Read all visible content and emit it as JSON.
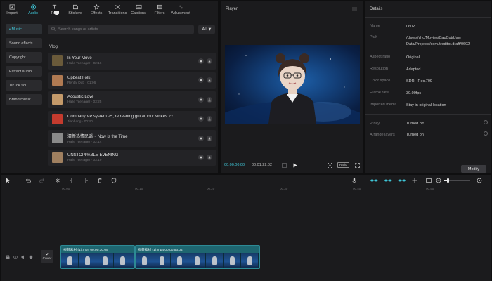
{
  "toolbar": {
    "items": [
      {
        "label": "Import",
        "icon": "import-icon"
      },
      {
        "label": "Audio",
        "icon": "audio-icon",
        "active": true
      },
      {
        "label": "Text",
        "icon": "text-icon"
      },
      {
        "label": "Stickers",
        "icon": "stickers-icon"
      },
      {
        "label": "Effects",
        "icon": "effects-icon"
      },
      {
        "label": "Transitions",
        "icon": "transitions-icon"
      },
      {
        "label": "Captions",
        "icon": "captions-icon"
      },
      {
        "label": "Filters",
        "icon": "filters-icon"
      },
      {
        "label": "Adjustment",
        "icon": "adjustment-icon"
      }
    ]
  },
  "sidebar": {
    "items": [
      {
        "label": "• Music",
        "active": true
      },
      {
        "label": "Sound effects"
      },
      {
        "label": "Copyright"
      },
      {
        "label": "Extract audio"
      },
      {
        "label": "TikTok sou..."
      },
      {
        "label": "Brand music"
      }
    ]
  },
  "search": {
    "placeholder": "Search songs or artists",
    "filter_label": "All"
  },
  "music": {
    "section": "Vlog",
    "tracks": [
      {
        "title": "Is Your Move",
        "sub": "Halle Teenager · 02:16",
        "thumb": "#6a5a3a"
      },
      {
        "title": "Upbeat Folk",
        "sub": "Rental Dub · 01:06",
        "thumb": "#b07a52"
      },
      {
        "title": "Acoustic Love",
        "sub": "Halle Teenager · 03:25",
        "thumb": "#c49a6a"
      },
      {
        "title": "Company VP system 25, refreshing guitar four strikes 2c",
        "sub": "Jianhang · 00:40",
        "thumb": "#c43b2e"
      },
      {
        "title": "清新热情民谣 ~ Now is the Time",
        "sub": "Halle Teenager · 02:14",
        "thumb": "#8a8a8a"
      },
      {
        "title": "UNSTOPPABLE EVENING",
        "sub": "Halle Teenager · 03:19",
        "thumb": "#a08060"
      }
    ]
  },
  "player": {
    "title": "Player",
    "current_time": "00:00:00:00",
    "total_time": "00:01:22:02",
    "ratio_label": "Ratio"
  },
  "details": {
    "title": "Details",
    "rows": [
      {
        "key": "Name",
        "value": "0602"
      },
      {
        "key": "Path",
        "value": "/Users/yhc/Movies/CapCut/User Data/Projects/com.lveditor.draft/0602"
      },
      {
        "key": "Aspect ratio",
        "value": "Original"
      },
      {
        "key": "Resolution",
        "value": "Adapted"
      },
      {
        "key": "Color space",
        "value": "SDR - Rec.709"
      },
      {
        "key": "Frame rate",
        "value": "30.00fps"
      },
      {
        "key": "Imported media",
        "value": "Stay in original location"
      }
    ],
    "toggles": [
      {
        "key": "Proxy",
        "value": "Turned off"
      },
      {
        "key": "Arrange layers",
        "value": "Turned on"
      }
    ],
    "modify_label": "Modify"
  },
  "timeline": {
    "ruler": [
      "00:00",
      "00:10",
      "00:20",
      "00:30",
      "00:40",
      "00:50"
    ],
    "cover_label": "Cover",
    "clips": [
      {
        "label": "视频素材 (1).mp4  00:00:30:05"
      },
      {
        "label": "视频素材 (1).mp4  00:00:53:04"
      }
    ]
  },
  "colors": {
    "accent": "#3fc5d6",
    "panel": "#1b1b1d",
    "clip": "#1e6670"
  }
}
